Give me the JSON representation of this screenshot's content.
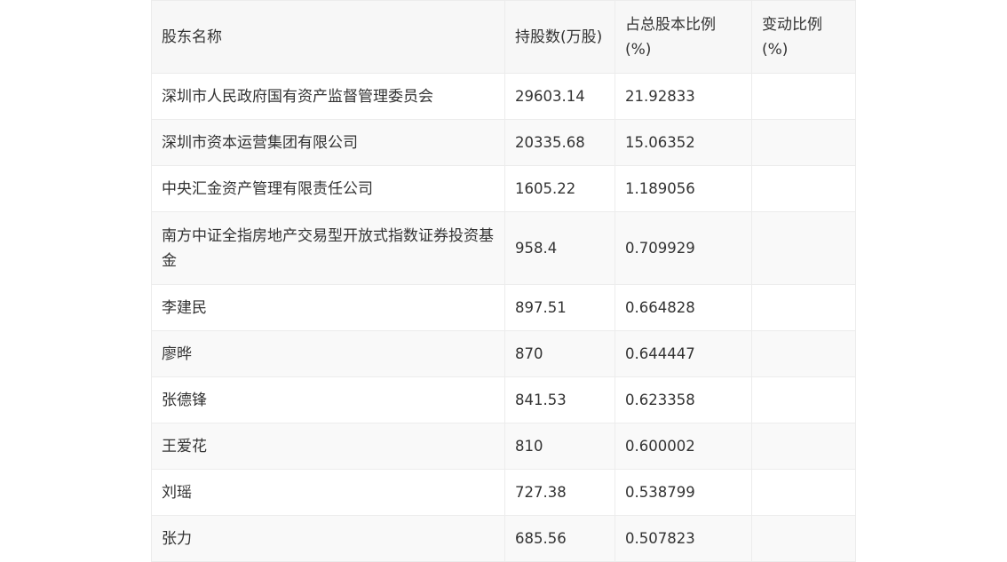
{
  "table": {
    "headers": [
      "股东名称",
      "持股数(万股)",
      "占总股本比例(%)",
      "变动比例(%)"
    ],
    "rows": [
      {
        "name": "深圳市人民政府国有资产监督管理委员会",
        "shares": "29603.14",
        "ratio": "21.92833",
        "change": ""
      },
      {
        "name": "深圳市资本运营集团有限公司",
        "shares": "20335.68",
        "ratio": "15.06352",
        "change": ""
      },
      {
        "name": "中央汇金资产管理有限责任公司",
        "shares": "1605.22",
        "ratio": "1.189056",
        "change": ""
      },
      {
        "name": "南方中证全指房地产交易型开放式指数证券投资基金",
        "shares": "958.4",
        "ratio": "0.709929",
        "change": ""
      },
      {
        "name": "李建民",
        "shares": "897.51",
        "ratio": "0.664828",
        "change": ""
      },
      {
        "name": "廖晔",
        "shares": "870",
        "ratio": "0.644447",
        "change": ""
      },
      {
        "name": "张德锋",
        "shares": "841.53",
        "ratio": "0.623358",
        "change": ""
      },
      {
        "name": "王爱花",
        "shares": "810",
        "ratio": "0.600002",
        "change": ""
      },
      {
        "name": "刘瑶",
        "shares": "727.38",
        "ratio": "0.538799",
        "change": ""
      },
      {
        "name": "张力",
        "shares": "685.56",
        "ratio": "0.507823",
        "change": ""
      }
    ]
  }
}
